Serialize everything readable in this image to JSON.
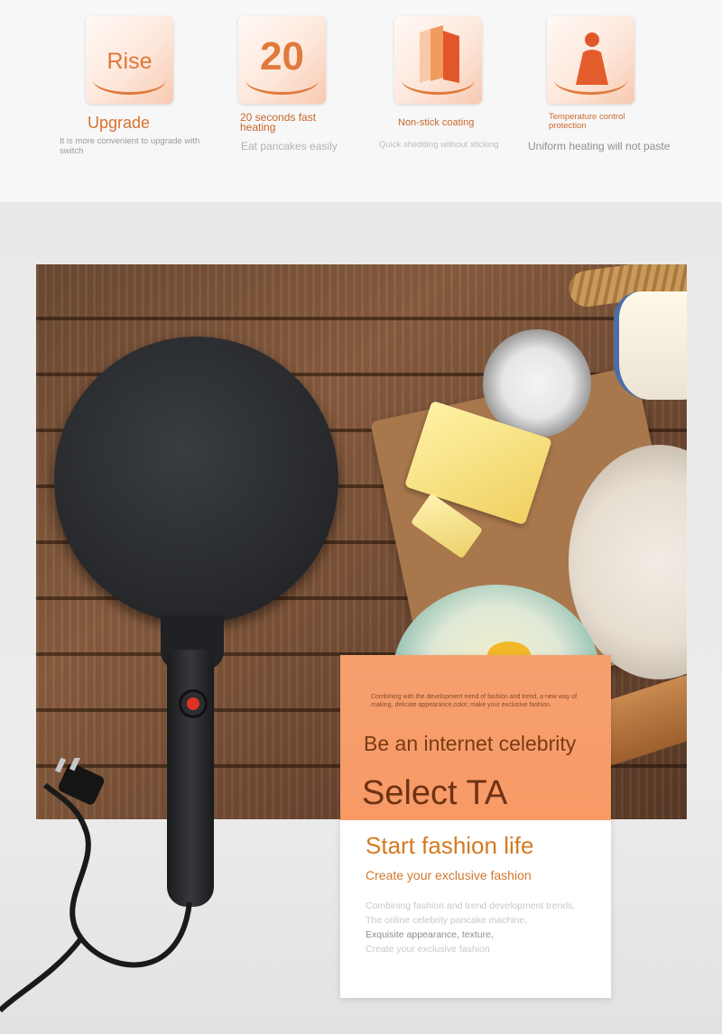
{
  "features": [
    {
      "icon": "rise-text-icon",
      "badge": "Rise",
      "title": "Upgrade",
      "subtitle": "It is more convenient to upgrade with switch"
    },
    {
      "icon": "twenty-seconds-icon",
      "badge": "20",
      "title": "20 seconds fast heating",
      "subtitle": "Eat pancakes easily"
    },
    {
      "icon": "non-stick-layers-icon",
      "badge": "",
      "title": "Non-stick coating",
      "subtitle": "Quick shedding without sticking"
    },
    {
      "icon": "person-icon",
      "badge": "",
      "title": "Temperature control protection",
      "subtitle": "Uniform heating will not paste"
    }
  ],
  "promo": {
    "small_text": "Combining with the development trend of fashion and trend, a new way of making, delicate appearance,color, make your exclusive fashion.",
    "headline": "Be an internet celebrity",
    "big": "Select TA",
    "tagline": "Start fashion life",
    "sub": "Create your exclusive fashion",
    "body": [
      "Combining fashion and trend development trends,",
      "The online celebrity pancake machine,",
      "Exquisite appearance, texture,",
      "Create your exclusive fashion"
    ]
  }
}
